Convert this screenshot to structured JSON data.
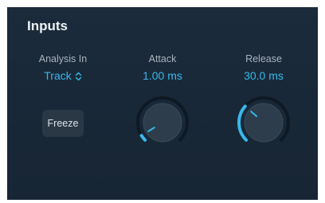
{
  "section": {
    "title": "Inputs"
  },
  "analysis_in": {
    "label": "Analysis In",
    "value": "Track",
    "icon": "up-down-chevron-icon"
  },
  "freeze": {
    "label": "Freeze"
  },
  "attack": {
    "label": "Attack",
    "value": "1.00 ms",
    "level": 0.05
  },
  "release": {
    "label": "Release",
    "value": "30.0 ms",
    "level": 0.32
  },
  "colors": {
    "panel_background": "#1b2b3b",
    "accent": "#38b8ec",
    "knob_track": "#0f1923",
    "knob_body": "#2e3d4b"
  }
}
